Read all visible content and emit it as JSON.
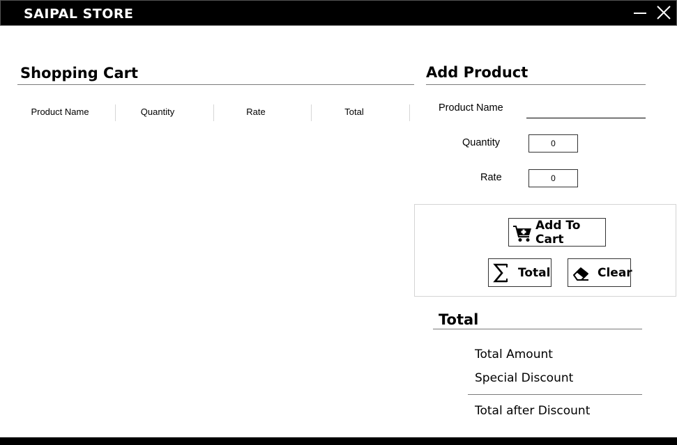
{
  "window": {
    "title": "SAIPAL STORE",
    "minimize_icon": "minimize-icon",
    "close_icon": "close-icon"
  },
  "cart": {
    "title": "Shopping Cart",
    "columns": [
      "Product Name",
      "Quantity",
      "Rate",
      "Total"
    ],
    "rows": []
  },
  "add_product": {
    "title": "Add Product",
    "product_name_label": "Product Name",
    "product_name_value": "",
    "quantity_label": "Quantity",
    "quantity_value": "0",
    "rate_label": "Rate",
    "rate_value": "0"
  },
  "actions": {
    "add_to_cart_label": "Add To Cart",
    "add_to_cart_icon": "cart-add-icon",
    "total_label": "Total",
    "total_icon": "sigma-icon",
    "clear_label": "Clear",
    "clear_icon": "eraser-icon"
  },
  "summary": {
    "title": "Total",
    "total_amount_label": "Total Amount",
    "special_discount_label": "Special Discount",
    "total_after_discount_label": "Total after Discount"
  },
  "colors": {
    "titlebar": "#000000",
    "background": "#ffffff",
    "rule": "#7a7a7a"
  }
}
